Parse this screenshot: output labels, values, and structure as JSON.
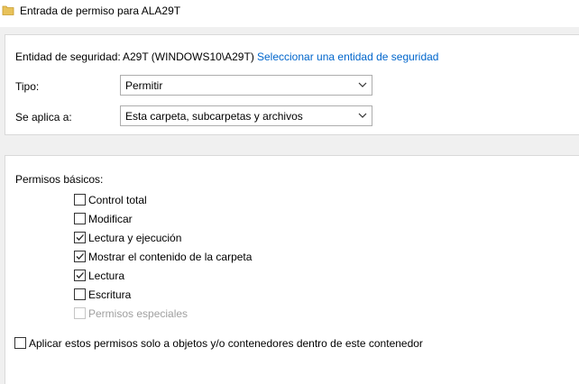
{
  "window": {
    "title": "Entrada de permiso para ALA29T",
    "title_icon": "folder-icon"
  },
  "principal": {
    "label": "Entidad de seguridad:",
    "value": "A29T (WINDOWS10\\A29T)",
    "link": "Seleccionar una entidad de seguridad"
  },
  "type": {
    "label": "Tipo:",
    "selected": "Permitir"
  },
  "applies_to": {
    "label": "Se aplica a:",
    "selected": "Esta carpeta, subcarpetas y archivos"
  },
  "permissions": {
    "heading": "Permisos básicos:",
    "items": [
      {
        "label": "Control total",
        "checked": false,
        "enabled": true
      },
      {
        "label": "Modificar",
        "checked": false,
        "enabled": true
      },
      {
        "label": "Lectura y ejecución",
        "checked": true,
        "enabled": true
      },
      {
        "label": "Mostrar el contenido de la carpeta",
        "checked": true,
        "enabled": true
      },
      {
        "label": "Lectura",
        "checked": true,
        "enabled": true
      },
      {
        "label": "Escritura",
        "checked": false,
        "enabled": true
      },
      {
        "label": "Permisos especiales",
        "checked": false,
        "enabled": false
      }
    ]
  },
  "apply_only": {
    "label": "Aplicar estos permisos solo a objetos y/o contenedores dentro de este contenedor",
    "checked": false
  },
  "colors": {
    "link": "#0066cc",
    "disabled_text": "#a0a0a0",
    "folder": "#e8c25a"
  }
}
